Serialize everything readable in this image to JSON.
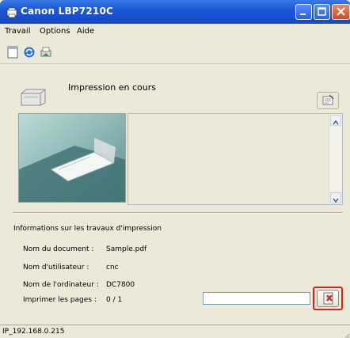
{
  "window": {
    "title": "Canon LBP7210C"
  },
  "menu": {
    "items": [
      "Travail",
      "Options",
      "Aide"
    ]
  },
  "toolbar": {
    "icons": [
      "page-icon",
      "refresh-icon",
      "printer-setup-icon"
    ]
  },
  "status": {
    "label": "Impression en cours"
  },
  "info": {
    "title": "Informations sur les travaux d'impression",
    "fields": [
      {
        "label": "Nom du document :",
        "value": "Sample.pdf"
      },
      {
        "label": "Nom d'utilisateur :",
        "value": "cnc"
      },
      {
        "label": "Nom de l'ordinateur :",
        "value": "DC7800"
      },
      {
        "label": "Imprimer les pages :",
        "value": "0 / 1"
      }
    ]
  },
  "progress": {
    "fraction": 0
  },
  "statusbar": {
    "text": "IP_192.168.0.215"
  },
  "colors": {
    "titlebar": "#1d57d6",
    "highlight": "#e0201c",
    "window_bg": "#ece9d8"
  }
}
